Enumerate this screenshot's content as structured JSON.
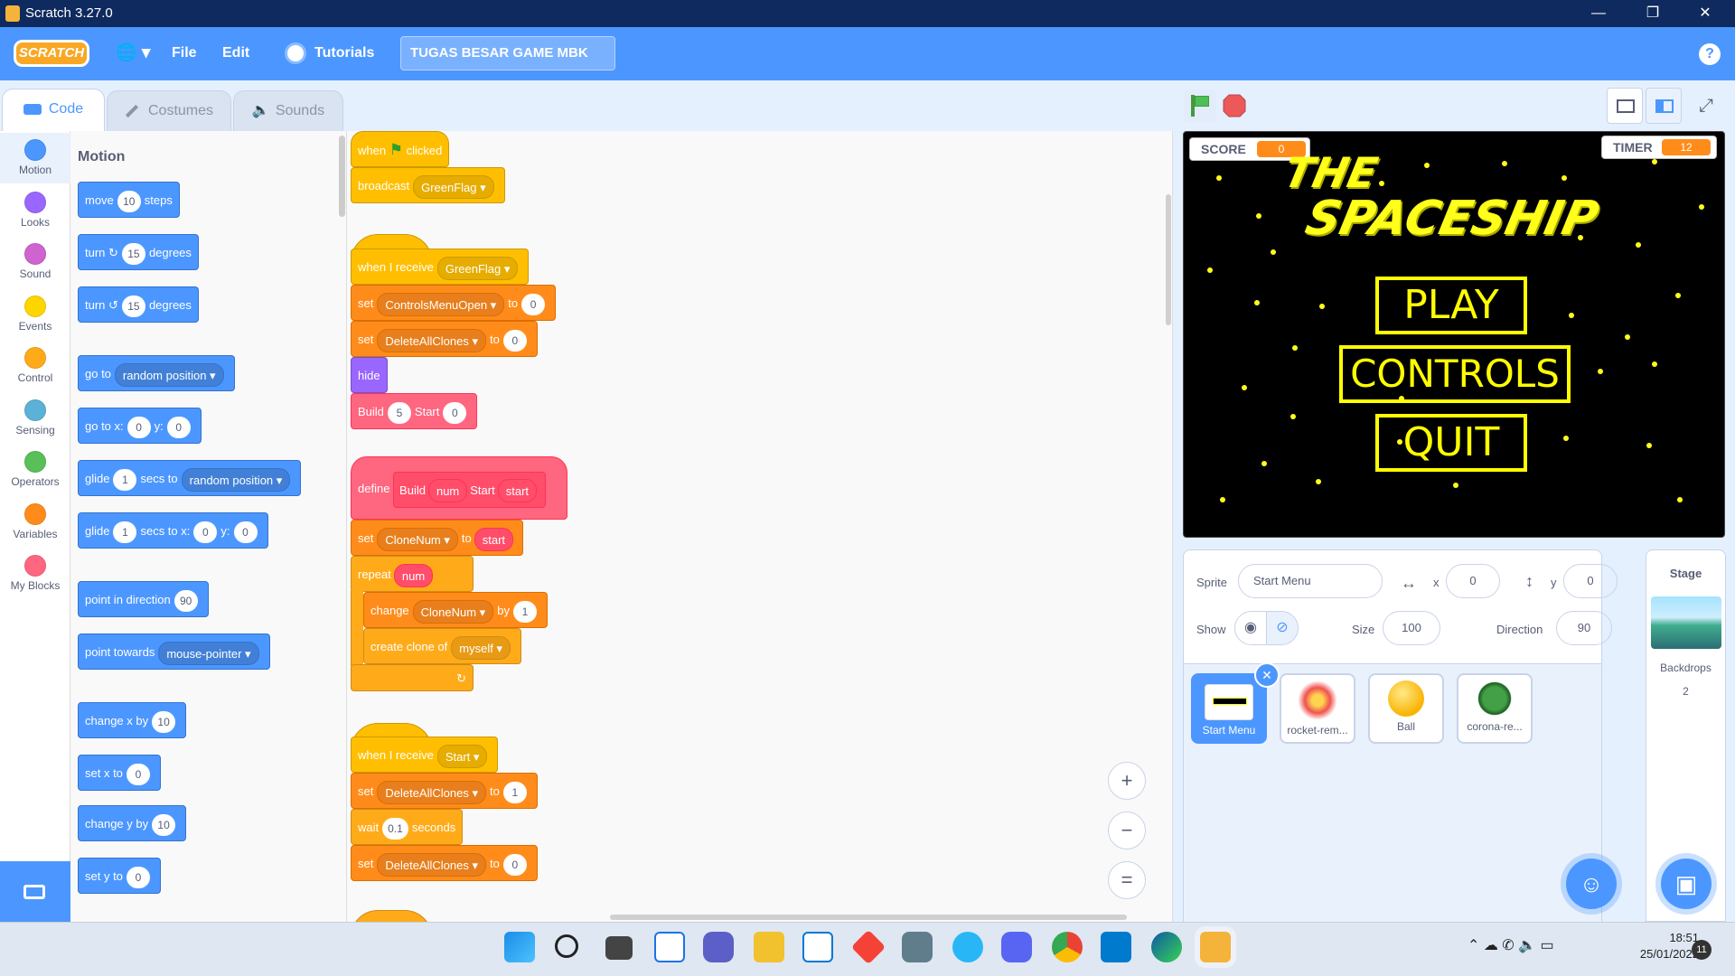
{
  "window": {
    "title": "Scratch 3.27.0",
    "controls": [
      "—",
      "❐",
      "✕"
    ]
  },
  "menu": {
    "logo": "SCRATCH",
    "globe": "🌐 ▾",
    "file": "File",
    "edit": "Edit",
    "tutorials": "Tutorials",
    "project_title": "TUGAS BESAR GAME MBK",
    "help": "?"
  },
  "tabs": {
    "code": "Code",
    "costumes": "Costumes",
    "sounds": "Sounds"
  },
  "categories": [
    {
      "label": "Motion",
      "color": "#4c97ff"
    },
    {
      "label": "Looks",
      "color": "#9966ff"
    },
    {
      "label": "Sound",
      "color": "#cf63cf"
    },
    {
      "label": "Events",
      "color": "#ffd500"
    },
    {
      "label": "Control",
      "color": "#ffab19"
    },
    {
      "label": "Sensing",
      "color": "#5cb1d6"
    },
    {
      "label": "Operators",
      "color": "#59c059"
    },
    {
      "label": "Variables",
      "color": "#ff8c1a"
    },
    {
      "label": "My Blocks",
      "color": "#ff6680"
    }
  ],
  "palette": {
    "heading": "Motion",
    "move": {
      "a": "move",
      "v": "10",
      "b": "steps"
    },
    "turn_r": {
      "a": "turn",
      "icon": "↻",
      "v": "15",
      "b": "degrees"
    },
    "turn_l": {
      "a": "turn",
      "icon": "↺",
      "v": "15",
      "b": "degrees"
    },
    "goto": {
      "a": "go to",
      "dd": "random position ▾"
    },
    "gotoxy": {
      "a": "go to x:",
      "x": "0",
      "b": "y:",
      "y": "0"
    },
    "glide": {
      "a": "glide",
      "v": "1",
      "b": "secs to",
      "dd": "random position ▾"
    },
    "glidexy": {
      "a": "glide",
      "v": "1",
      "b": "secs to x:",
      "x": "0",
      "c": "y:",
      "y": "0"
    },
    "point": {
      "a": "point in direction",
      "v": "90"
    },
    "towards": {
      "a": "point towards",
      "dd": "mouse-pointer ▾"
    },
    "changex": {
      "a": "change x by",
      "v": "10"
    },
    "setx": {
      "a": "set x to",
      "v": "0"
    },
    "changey": {
      "a": "change y by",
      "v": "10"
    },
    "sety": {
      "a": "set y to",
      "v": "0"
    }
  },
  "scripts": {
    "s1": {
      "when": "when",
      "clicked": "clicked",
      "broadcast": "broadcast",
      "bmsg": "GreenFlag ▾"
    },
    "s2": {
      "hat": "when I receive",
      "msg": "GreenFlag ▾",
      "set1": {
        "a": "set",
        "dd": "ControlsMenuOpen ▾",
        "b": "to",
        "v": "0"
      },
      "set2": {
        "a": "set",
        "dd": "DeleteAllClones ▾",
        "b": "to",
        "v": "0"
      },
      "hide": "hide",
      "build": {
        "a": "Build",
        "v": "5",
        "b": "Start",
        "v2": "0"
      }
    },
    "s3": {
      "define": "define",
      "name": "Build",
      "p1": "num",
      "lbl": "Start",
      "p2": "start",
      "set": {
        "a": "set",
        "dd": "CloneNum ▾",
        "b": "to",
        "p": "start"
      },
      "repeat": {
        "a": "repeat",
        "p": "num"
      },
      "change": {
        "a": "change",
        "dd": "CloneNum ▾",
        "b": "by",
        "v": "1"
      },
      "clone": {
        "a": "create clone of",
        "dd": "myself ▾"
      },
      "loop": "↻"
    },
    "s4": {
      "hat": "when I receive",
      "msg": "Start ▾",
      "set1": {
        "a": "set",
        "dd": "DeleteAllClones ▾",
        "b": "to",
        "v": "1"
      },
      "wait": {
        "a": "wait",
        "v": "0.1",
        "b": "seconds"
      },
      "set2": {
        "a": "set",
        "dd": "DeleteAllClones ▾",
        "b": "to",
        "v": "0"
      }
    }
  },
  "zoom": {
    "in": "+",
    "out": "−",
    "reset": "="
  },
  "stage": {
    "score_label": "SCORE",
    "score": "0",
    "timer_label": "TIMER",
    "timer": "12",
    "title1": "THE",
    "title2": "SPACESHIP",
    "play": "PLAY",
    "controls": "CONTROLS",
    "quit": "QUIT"
  },
  "sprite_info": {
    "sprite_label": "Sprite",
    "sprite_name": "Start Menu",
    "x_label": "x",
    "x": "0",
    "y_label": "y",
    "y": "0",
    "show_label": "Show",
    "size_label": "Size",
    "size": "100",
    "direction_label": "Direction",
    "direction": "90"
  },
  "sprites": [
    {
      "name": "Start Menu",
      "selected": true
    },
    {
      "name": "rocket-rem...",
      "selected": false
    },
    {
      "name": "Ball",
      "selected": false
    },
    {
      "name": "corona-re...",
      "selected": false
    }
  ],
  "stage_panel": {
    "title": "Stage",
    "backdrops_label": "Backdrops",
    "backdrops": "2"
  },
  "taskbar": {
    "time": "18:51",
    "date": "25/01/2022",
    "badge": "11"
  }
}
